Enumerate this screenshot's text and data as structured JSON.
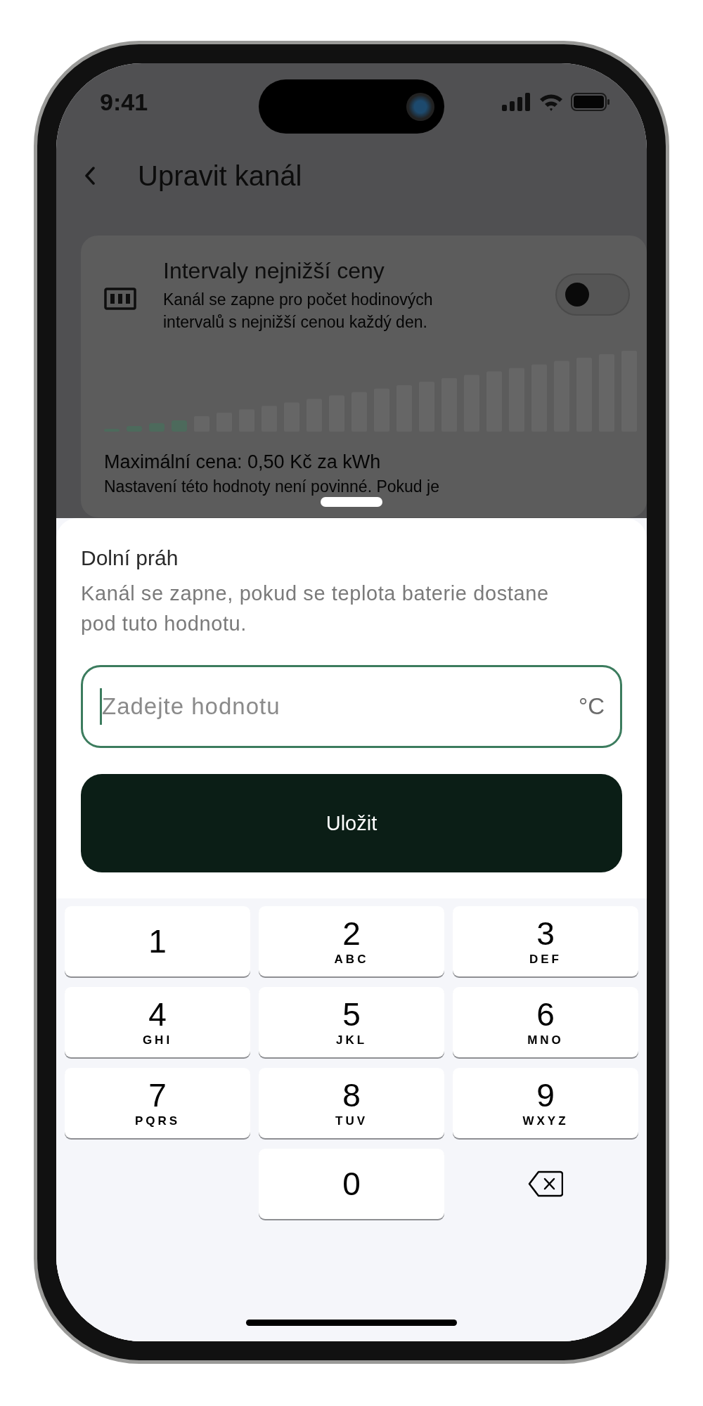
{
  "status_bar": {
    "time": "9:41"
  },
  "header": {
    "title": "Upravit kanál"
  },
  "channel_card": {
    "title": "Intervaly nejnižší ceny",
    "description": "Kanál se zapne pro počet hodinových intervalů s nejnižší cenou každý den.",
    "on": false,
    "max_price": {
      "title": "Maximální cena: 0,50 Kč za kWh",
      "description": "Nastavení této hodnoty není povinné. Pokud je"
    }
  },
  "sheet": {
    "title": "Dolní práh",
    "description": "Kanál se zapne, pokud se teplota baterie dostane pod tuto hodnotu.",
    "field": {
      "placeholder": "Zadejte hodnotu",
      "unit": "°C",
      "focused": true
    },
    "button": "Uložit"
  },
  "keypad": {
    "keys": [
      {
        "kind": "digit",
        "digit": "1"
      },
      {
        "kind": "digit",
        "digit": "2",
        "letters": "ABC"
      },
      {
        "kind": "digit",
        "digit": "3",
        "letters": "DEF"
      },
      {
        "kind": "digit",
        "digit": "4",
        "letters": "GHI"
      },
      {
        "kind": "digit",
        "digit": "5",
        "letters": "JKL"
      },
      {
        "kind": "digit",
        "digit": "6",
        "letters": "MNO"
      },
      {
        "kind": "digit",
        "digit": "7",
        "letters": "PQRS"
      },
      {
        "kind": "digit",
        "digit": "8",
        "letters": "TUV"
      },
      {
        "kind": "digit",
        "digit": "9",
        "letters": "WXYZ"
      },
      {
        "kind": "blank"
      },
      {
        "kind": "digit",
        "digit": "0"
      },
      {
        "kind": "backspace"
      }
    ]
  }
}
